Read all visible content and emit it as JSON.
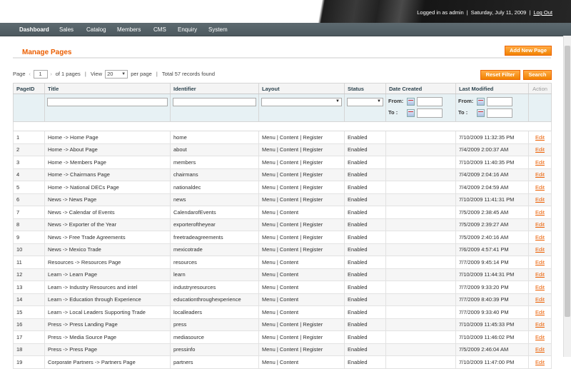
{
  "header": {
    "logged_in": "Logged in as admin",
    "date": "Saturday, July 11, 2009",
    "logout": "Log Out",
    "separator": "|"
  },
  "nav": {
    "items": [
      {
        "label": "Dashboard",
        "active": true
      },
      {
        "label": "Sales"
      },
      {
        "label": "Catalog"
      },
      {
        "label": "Members"
      },
      {
        "label": "CMS"
      },
      {
        "label": "Enquiry"
      },
      {
        "label": "System"
      }
    ]
  },
  "page": {
    "title": "Manage Pages",
    "add_button": "Add New Page"
  },
  "pager": {
    "page_label": "Page",
    "page_value": "1",
    "of_pages": "of 1 pages",
    "view_label": "View",
    "per_page_value": "20",
    "per_page_label": "per page",
    "total": "Total 57 records found",
    "separator": "|",
    "reset_filter": "Reset Filter",
    "search": "Search"
  },
  "grid": {
    "columns": [
      "PageID",
      "Title",
      "Identifier",
      "Layout",
      "Status",
      "Date Created",
      "Last Modified",
      "Action"
    ],
    "filter_from": "From:",
    "filter_to": "To :",
    "rows": [
      [
        "1",
        "Home -> Home Page",
        "home",
        "Menu | Content | Register",
        "Enabled",
        "7/10/2009 11:32:35 PM",
        "Edit"
      ],
      [
        "2",
        "Home -> About Page",
        "about",
        "Menu | Content | Register",
        "Enabled",
        "7/4/2009 2:00:37 AM",
        "Edit"
      ],
      [
        "3",
        "Home -> Members Page",
        "members",
        "Menu | Content | Register",
        "Enabled",
        "7/10/2009 11:40:35 PM",
        "Edit"
      ],
      [
        "4",
        "Home -> Chairmans Page",
        "chairmans",
        "Menu | Content | Register",
        "Enabled",
        "7/4/2009 2:04:16 AM",
        "Edit"
      ],
      [
        "5",
        "Home -> National DECs Page",
        "nationaldec",
        "Menu | Content | Register",
        "Enabled",
        "7/4/2009 2:04:59 AM",
        "Edit"
      ],
      [
        "6",
        "News -> News Page",
        "news",
        "Menu | Content | Register",
        "Enabled",
        "7/10/2009 11:41:31 PM",
        "Edit"
      ],
      [
        "7",
        "News -> Calendar of Events",
        "CalendarofEvents",
        "Menu | Content",
        "Enabled",
        "7/5/2009 2:38:45 AM",
        "Edit"
      ],
      [
        "8",
        "News -> Exporter of the Year",
        "exporteroftheyear",
        "Menu | Content | Register",
        "Enabled",
        "7/5/2009 2:39:27 AM",
        "Edit"
      ],
      [
        "9",
        "News -> Free Trade Agreements",
        "freetradeagreements",
        "Menu | Content | Register",
        "Enabled",
        "7/5/2009 2:40:16 AM",
        "Edit"
      ],
      [
        "10",
        "News -> Mexico Trade",
        "mexicotrade",
        "Menu | Content | Register",
        "Enabled",
        "7/6/2009 4:57:41 PM",
        "Edit"
      ],
      [
        "11",
        "Resources -> Resources Page",
        "resources",
        "Menu | Content",
        "Enabled",
        "7/7/2009 9:45:14 PM",
        "Edit"
      ],
      [
        "12",
        "Learn -> Learn Page",
        "learn",
        "Menu | Content",
        "Enabled",
        "7/10/2009 11:44:31 PM",
        "Edit"
      ],
      [
        "13",
        "Learn -> Industry Resources and intel",
        "industryresources",
        "Menu | Content",
        "Enabled",
        "7/7/2009 9:33:20 PM",
        "Edit"
      ],
      [
        "14",
        "Learn -> Education through Experience",
        "educationthroughexperience",
        "Menu | Content",
        "Enabled",
        "7/7/2009 8:40:39 PM",
        "Edit"
      ],
      [
        "15",
        "Learn -> Local Leaders Supporting Trade",
        "localleaders",
        "Menu | Content",
        "Enabled",
        "7/7/2009 9:33:40 PM",
        "Edit"
      ],
      [
        "16",
        "Press -> Press Landing Page",
        "press",
        "Menu | Content | Register",
        "Enabled",
        "7/10/2009 11:45:33 PM",
        "Edit"
      ],
      [
        "17",
        "Press -> Media Source Page",
        "mediasource",
        "Menu | Content | Register",
        "Enabled",
        "7/10/2009 11:46:02 PM",
        "Edit"
      ],
      [
        "18",
        "Press -> Press Page",
        "pressinfo",
        "Menu | Content | Register",
        "Enabled",
        "7/5/2009 2:46:04 AM",
        "Edit"
      ],
      [
        "19",
        "Corporate Partners -> Partners Page",
        "partners",
        "Menu | Content",
        "Enabled",
        "7/10/2009 11:47:00 PM",
        "Edit"
      ]
    ]
  }
}
